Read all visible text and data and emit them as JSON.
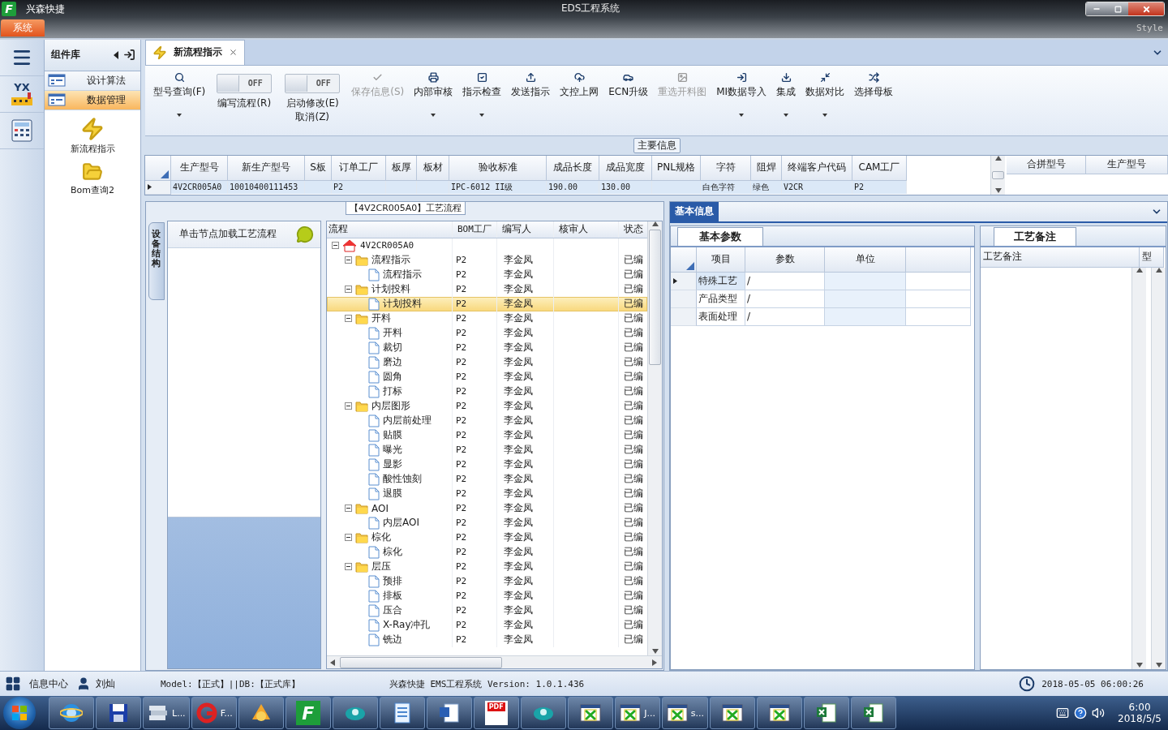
{
  "window": {
    "logo_letter": "F",
    "app_name": "兴森快捷",
    "title": "EDS工程系统",
    "system_tab": "系统",
    "style_label": "Style"
  },
  "rail": {
    "logo_text": "YX"
  },
  "component_panel": {
    "title": "组件库",
    "items": [
      {
        "label": "设计算法",
        "selected": false
      },
      {
        "label": "数据管理",
        "selected": true
      }
    ],
    "launchers": [
      {
        "kind": "bolt",
        "label": "新流程指示"
      },
      {
        "kind": "folder",
        "label": "Bom查询2"
      }
    ]
  },
  "tabs": [
    {
      "label": "新流程指示",
      "selected": true
    }
  ],
  "ribbon": {
    "items": [
      {
        "kind": "button",
        "label": "型号查询(F)",
        "disabled": false,
        "dropdown": true
      },
      {
        "kind": "toggle",
        "label": "编写流程(R)",
        "toggle_text": "OFF",
        "on": false
      },
      {
        "kind": "toggle",
        "label": "启动修改(E)",
        "sublabel": "取消(Z)",
        "toggle_text": "OFF",
        "on": false
      },
      {
        "kind": "button",
        "label": "保存信息(S)",
        "disabled": true,
        "dropdown": false
      },
      {
        "kind": "button",
        "label": "内部审核",
        "disabled": false,
        "dropdown": true
      },
      {
        "kind": "button",
        "label": "指示检查",
        "disabled": false,
        "dropdown": true
      },
      {
        "kind": "button",
        "label": "发送指示",
        "disabled": false,
        "dropdown": false
      },
      {
        "kind": "button",
        "label": "文控上网",
        "disabled": false,
        "dropdown": false
      },
      {
        "kind": "button",
        "label": "ECN升级",
        "disabled": false,
        "dropdown": false
      },
      {
        "kind": "button",
        "label": "重选开料图",
        "disabled": true,
        "dropdown": false
      },
      {
        "kind": "button",
        "label": "MI数据导入",
        "disabled": false,
        "dropdown": true
      },
      {
        "kind": "button",
        "label": "集成",
        "disabled": false,
        "dropdown": true
      },
      {
        "kind": "button",
        "label": "数据对比",
        "disabled": false,
        "dropdown": true
      },
      {
        "kind": "button",
        "label": "选择母板",
        "disabled": false,
        "dropdown": false
      }
    ]
  },
  "main_info": {
    "title": "主要信息",
    "columns": [
      "生产型号",
      "新生产型号",
      "S板",
      "订单工厂",
      "板厚",
      "板材",
      "验收标准",
      "成品长度",
      "成品宽度",
      "PNL规格",
      "字符",
      "阻焊",
      "终端客户代码",
      "CAM工厂"
    ],
    "rows": [
      {
        "selected": true,
        "cells": [
          "4V2CR005A0",
          "10010400111453",
          null,
          "P2",
          null,
          null,
          "IPC-6012 II级",
          "190.00",
          "130.00",
          null,
          "白色字符",
          "绿色",
          "V2CR",
          "P2"
        ]
      }
    ],
    "side_columns": [
      "合拼型号",
      "生产型号"
    ]
  },
  "process": {
    "legend": "【4V2CR005A0】工艺流程",
    "side_tab": "设备结构",
    "hint": "单击节点加载工艺流程",
    "columns": [
      "流程",
      "BOM工厂",
      "编写人",
      "核审人",
      "状态"
    ],
    "tree": [
      {
        "name": "4V2CR005A0",
        "kind": "root",
        "expanded": true,
        "selected": false,
        "children": [
          {
            "name": "流程指示",
            "kind": "folder",
            "bom": "P2",
            "writer": "李金凤",
            "status": "已编",
            "expanded": true,
            "selected": false,
            "children": [
              {
                "name": "流程指示",
                "kind": "step",
                "bom": "P2",
                "writer": "李金凤",
                "status": "已编",
                "selected": false
              }
            ]
          },
          {
            "name": "计划投料",
            "kind": "folder",
            "bom": "P2",
            "writer": "李金凤",
            "status": "已编",
            "expanded": true,
            "selected": false,
            "children": [
              {
                "name": "计划投料",
                "kind": "step",
                "bom": "P2",
                "writer": "李金凤",
                "status": "已编",
                "selected": true
              }
            ]
          },
          {
            "name": "开料",
            "kind": "folder",
            "bom": "P2",
            "writer": "李金凤",
            "status": "已编",
            "expanded": true,
            "selected": false,
            "children": [
              {
                "name": "开料",
                "kind": "step",
                "bom": "P2",
                "writer": "李金凤",
                "status": "已编",
                "selected": false
              },
              {
                "name": "裁切",
                "kind": "step",
                "bom": "P2",
                "writer": "李金凤",
                "status": "已编",
                "selected": false
              },
              {
                "name": "磨边",
                "kind": "step",
                "bom": "P2",
                "writer": "李金凤",
                "status": "已编",
                "selected": false
              },
              {
                "name": "圆角",
                "kind": "step",
                "bom": "P2",
                "writer": "李金凤",
                "status": "已编",
                "selected": false
              },
              {
                "name": "打标",
                "kind": "step",
                "bom": "P2",
                "writer": "李金凤",
                "status": "已编",
                "selected": false
              }
            ]
          },
          {
            "name": "内层图形",
            "kind": "folder",
            "bom": "P2",
            "writer": "李金凤",
            "status": "已编",
            "expanded": true,
            "selected": false,
            "children": [
              {
                "name": "内层前处理",
                "kind": "step",
                "bom": "P2",
                "writer": "李金凤",
                "status": "已编",
                "selected": false
              },
              {
                "name": "贴膜",
                "kind": "step",
                "bom": "P2",
                "writer": "李金凤",
                "status": "已编",
                "selected": false
              },
              {
                "name": "曝光",
                "kind": "step",
                "bom": "P2",
                "writer": "李金凤",
                "status": "已编",
                "selected": false
              },
              {
                "name": "显影",
                "kind": "step",
                "bom": "P2",
                "writer": "李金凤",
                "status": "已编",
                "selected": false
              },
              {
                "name": "酸性蚀刻",
                "kind": "step",
                "bom": "P2",
                "writer": "李金凤",
                "status": "已编",
                "selected": false
              },
              {
                "name": "退膜",
                "kind": "step",
                "bom": "P2",
                "writer": "李金凤",
                "status": "已编",
                "selected": false
              }
            ]
          },
          {
            "name": "AOI",
            "kind": "folder",
            "bom": "P2",
            "writer": "李金凤",
            "status": "已编",
            "expanded": true,
            "selected": false,
            "children": [
              {
                "name": "内层AOI",
                "kind": "step",
                "bom": "P2",
                "writer": "李金凤",
                "status": "已编",
                "selected": false
              }
            ]
          },
          {
            "name": "棕化",
            "kind": "folder",
            "bom": "P2",
            "writer": "李金凤",
            "status": "已编",
            "expanded": true,
            "selected": false,
            "children": [
              {
                "name": "棕化",
                "kind": "step",
                "bom": "P2",
                "writer": "李金凤",
                "status": "已编",
                "selected": false
              }
            ]
          },
          {
            "name": "层压",
            "kind": "folder",
            "bom": "P2",
            "writer": "李金凤",
            "status": "已编",
            "expanded": true,
            "selected": false,
            "children": [
              {
                "name": "预排",
                "kind": "step",
                "bom": "P2",
                "writer": "李金凤",
                "status": "已编",
                "selected": false
              },
              {
                "name": "排板",
                "kind": "step",
                "bom": "P2",
                "writer": "李金凤",
                "status": "已编",
                "selected": false
              },
              {
                "name": "压合",
                "kind": "step",
                "bom": "P2",
                "writer": "李金凤",
                "status": "已编",
                "selected": false
              },
              {
                "name": "X-Ray冲孔",
                "kind": "step",
                "bom": "P2",
                "writer": "李金凤",
                "status": "已编",
                "selected": false
              },
              {
                "name": "铣边",
                "kind": "step",
                "bom": "P2",
                "writer": "李金凤",
                "status": "已编",
                "selected": false
              }
            ]
          }
        ]
      }
    ]
  },
  "basic_info": {
    "title": "基本信息",
    "params": {
      "tab": "基本参数",
      "columns": [
        "项目",
        "参数",
        "单位"
      ],
      "rows": [
        {
          "item": "特殊工艺",
          "value": "/",
          "selected": true
        },
        {
          "item": "产品类型",
          "value": "/",
          "selected": false
        },
        {
          "item": "表面处理",
          "value": "/",
          "selected": false
        }
      ]
    },
    "notes": {
      "tab": "工艺备注",
      "columns": [
        "工艺备注",
        "型"
      ]
    }
  },
  "status_bar": {
    "info_center": "信息中心",
    "user": "刘灿",
    "model": "Model:【正式】||DB:【正式库】",
    "version": "兴森快捷 EMS工程系统 Version: 1.0.1.436",
    "datetime": "2018-05-05 06:00:26"
  },
  "taskbar": {
    "apps": [
      {
        "kind": "browser"
      },
      {
        "kind": "disk"
      },
      {
        "kind": "stack",
        "label": "L..."
      },
      {
        "kind": "swirl",
        "label": "F..."
      },
      {
        "kind": "shell"
      },
      {
        "kind": "logo",
        "letter": "F"
      },
      {
        "kind": "teal"
      },
      {
        "kind": "notes"
      },
      {
        "kind": "word"
      },
      {
        "kind": "pdf",
        "letter": "PDF"
      },
      {
        "kind": "teal"
      },
      {
        "kind": "sheet"
      },
      {
        "kind": "sheet",
        "label": "J..."
      },
      {
        "kind": "sheet",
        "label": "s..."
      },
      {
        "kind": "sheet"
      },
      {
        "kind": "sheet"
      },
      {
        "kind": "excel"
      },
      {
        "kind": "excel"
      }
    ],
    "time": "6:00",
    "date": "2018/5/5"
  }
}
